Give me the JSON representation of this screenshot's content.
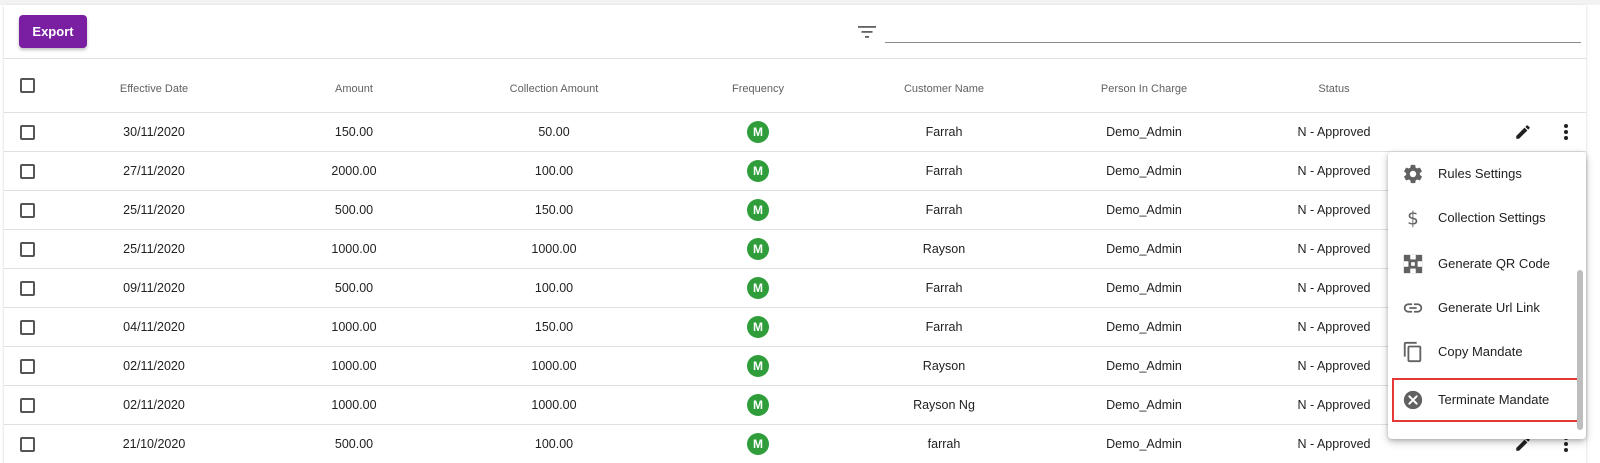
{
  "toolbar": {
    "export_label": "Export",
    "search_value": ""
  },
  "table": {
    "headers": [
      "Effective Date",
      "Amount",
      "Collection Amount",
      "Frequency",
      "Customer Name",
      "Person In Charge",
      "Status"
    ],
    "rows": [
      {
        "date": "30/11/2020",
        "amount": "150.00",
        "collection": "50.00",
        "frequency": "M",
        "customer": "Farrah",
        "pic": "Demo_Admin",
        "status": "N - Approved"
      },
      {
        "date": "27/11/2020",
        "amount": "2000.00",
        "collection": "100.00",
        "frequency": "M",
        "customer": "Farrah",
        "pic": "Demo_Admin",
        "status": "N - Approved"
      },
      {
        "date": "25/11/2020",
        "amount": "500.00",
        "collection": "150.00",
        "frequency": "M",
        "customer": "Farrah",
        "pic": "Demo_Admin",
        "status": "N - Approved"
      },
      {
        "date": "25/11/2020",
        "amount": "1000.00",
        "collection": "1000.00",
        "frequency": "M",
        "customer": "Rayson",
        "pic": "Demo_Admin",
        "status": "N - Approved"
      },
      {
        "date": "09/11/2020",
        "amount": "500.00",
        "collection": "100.00",
        "frequency": "M",
        "customer": "Farrah",
        "pic": "Demo_Admin",
        "status": "N - Approved"
      },
      {
        "date": "04/11/2020",
        "amount": "1000.00",
        "collection": "150.00",
        "frequency": "M",
        "customer": "Farrah",
        "pic": "Demo_Admin",
        "status": "N - Approved"
      },
      {
        "date": "02/11/2020",
        "amount": "1000.00",
        "collection": "1000.00",
        "frequency": "M",
        "customer": "Rayson",
        "pic": "Demo_Admin",
        "status": "N - Approved"
      },
      {
        "date": "02/11/2020",
        "amount": "1000.00",
        "collection": "1000.00",
        "frequency": "M",
        "customer": "Rayson Ng",
        "pic": "Demo_Admin",
        "status": "N - Approved"
      },
      {
        "date": "21/10/2020",
        "amount": "500.00",
        "collection": "100.00",
        "frequency": "M",
        "customer": "farrah",
        "pic": "Demo_Admin",
        "status": "N - Approved"
      }
    ]
  },
  "menu": {
    "items": [
      {
        "label": "Rules Settings",
        "icon": "gear-icon"
      },
      {
        "label": "Collection Settings",
        "icon": "dollar-icon"
      },
      {
        "label": "Generate QR Code",
        "icon": "qr-code-icon"
      },
      {
        "label": "Generate Url Link",
        "icon": "link-icon"
      },
      {
        "label": "Copy Mandate",
        "icon": "copy-icon"
      },
      {
        "label": "Terminate Mandate",
        "icon": "cancel-circle-icon"
      }
    ]
  },
  "colors": {
    "accent": "#7b1fa2",
    "frequency_badge": "#2e9d3a",
    "highlight": "#e53935"
  }
}
